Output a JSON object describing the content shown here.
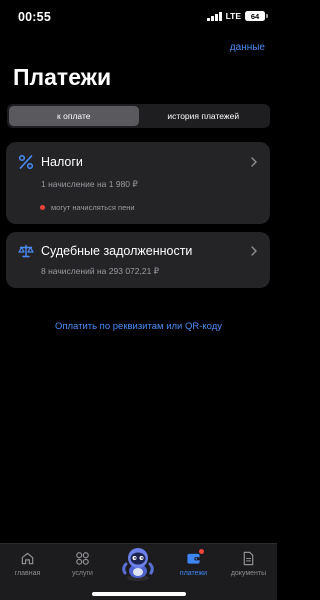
{
  "status_bar": {
    "time": "00:55",
    "network": "LTE",
    "battery": "64"
  },
  "header": {
    "data_link": "данные",
    "title": "Платежи"
  },
  "segments": {
    "tab_to_pay": "к оплате",
    "tab_history": "история платежей",
    "active": "к оплате"
  },
  "cards": [
    {
      "title": "Налоги",
      "subtitle": "1 начисление на 1 980 ₽",
      "warning": "могут начисляться пени",
      "icon": "percent-icon"
    },
    {
      "title": "Судебные задолженности",
      "subtitle": "8 начислений на 293 072,21 ₽",
      "icon": "scales-icon"
    }
  ],
  "pay_link": "Оплатить по реквизитам или QR-коду",
  "tab_bar": {
    "items": [
      {
        "label": "главная",
        "icon": "home-icon"
      },
      {
        "label": "услуги",
        "icon": "grid-icon"
      },
      {
        "label": "",
        "icon": "robot-mascot-icon"
      },
      {
        "label": "платежи",
        "icon": "wallet-icon",
        "active": true
      },
      {
        "label": "документы",
        "icon": "document-icon"
      }
    ]
  },
  "colors": {
    "accent": "#4a8df8",
    "warning": "#f0433a",
    "card": "#242427",
    "background": "#000000"
  }
}
